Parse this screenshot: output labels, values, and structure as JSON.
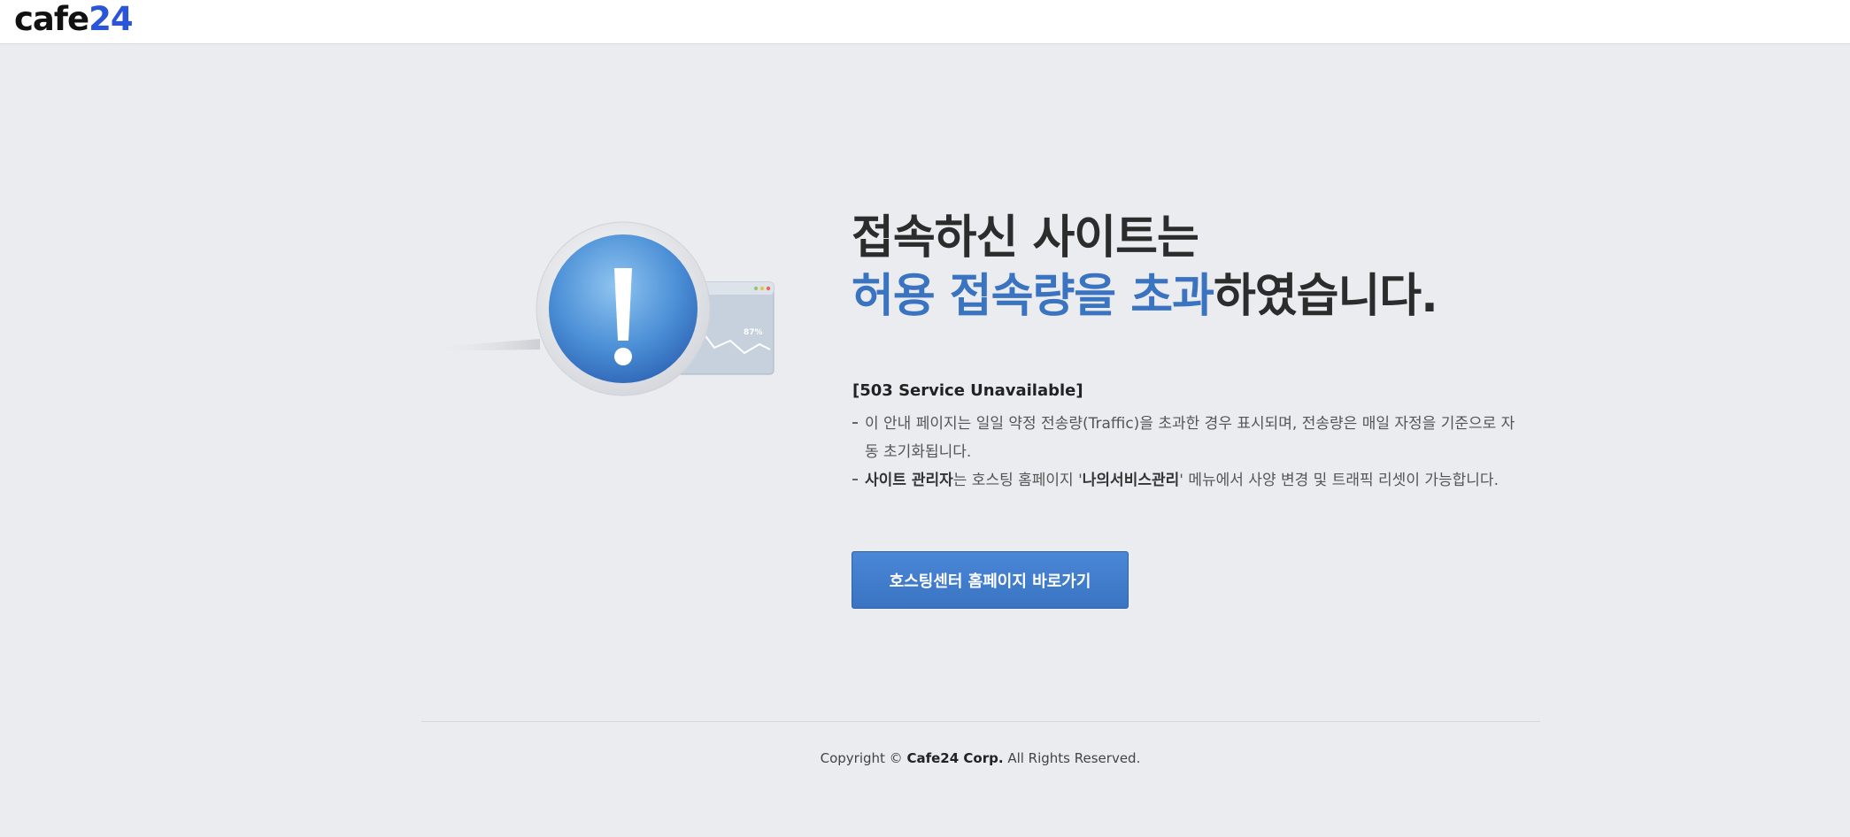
{
  "logo": {
    "part1": "cafe",
    "part2": "24"
  },
  "headline": {
    "line1": "접속하신 사이트는",
    "line2_highlight": "허용 접속량을 초과",
    "line2_rest": "하였습니다."
  },
  "status_title": "[503 Service Unavailable]",
  "notes": [
    {
      "text": "이 안내 페이지는 일일 약정 전송량(Traffic)을 초과한 경우 표시되며, 전송량은 매일 자정을 기준으로 자동 초기화됩니다."
    },
    {
      "bold1": "사이트 관리자",
      "text1": "는 호스팅 홈페이지 '",
      "bold2": "나의서비스관리",
      "text2": "' 메뉴에서 사양 변경 및 트래픽 리셋이 가능합니다."
    }
  ],
  "cta_label": "호스팅센터 홈페이지 바로가기",
  "illustration": {
    "chart_label": "87%"
  },
  "footer": {
    "prefix": "Copyright © ",
    "company": "Cafe24 Corp.",
    "suffix": " All Rights Reserved."
  },
  "colors": {
    "accent": "#3a73c0",
    "logo_blue": "#2a55d8",
    "background": "#ebecf0"
  }
}
